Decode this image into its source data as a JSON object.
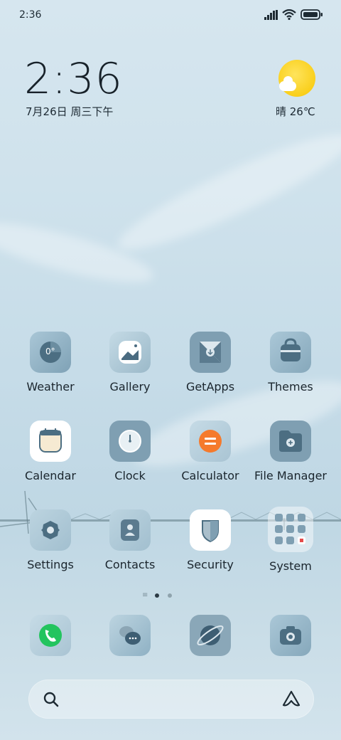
{
  "status_bar": {
    "time": "2:36"
  },
  "widget": {
    "clock": "2:36",
    "date": "7月26日 周三下午",
    "weather": "晴 26℃"
  },
  "apps": [
    {
      "label": "Weather",
      "icon": "weather-icon",
      "badge": "0°"
    },
    {
      "label": "Gallery",
      "icon": "gallery-icon"
    },
    {
      "label": "GetApps",
      "icon": "getapps-icon"
    },
    {
      "label": "Themes",
      "icon": "themes-icon"
    },
    {
      "label": "Calendar",
      "icon": "calendar-icon"
    },
    {
      "label": "Clock",
      "icon": "clock-icon"
    },
    {
      "label": "Calculator",
      "icon": "calculator-icon"
    },
    {
      "label": "File Manager",
      "icon": "file-manager-icon"
    },
    {
      "label": "Settings",
      "icon": "settings-icon"
    },
    {
      "label": "Contacts",
      "icon": "contacts-icon"
    },
    {
      "label": "Security",
      "icon": "security-icon"
    },
    {
      "label": "System",
      "icon": "system-folder-icon"
    }
  ],
  "dock": [
    {
      "name": "phone-icon"
    },
    {
      "name": "messages-icon"
    },
    {
      "name": "browser-icon"
    },
    {
      "name": "camera-icon"
    }
  ],
  "page_indicator": {
    "pages": 2,
    "active": 0
  },
  "search": {
    "left_icon": "search-icon",
    "right_icon": "assistant-icon"
  }
}
